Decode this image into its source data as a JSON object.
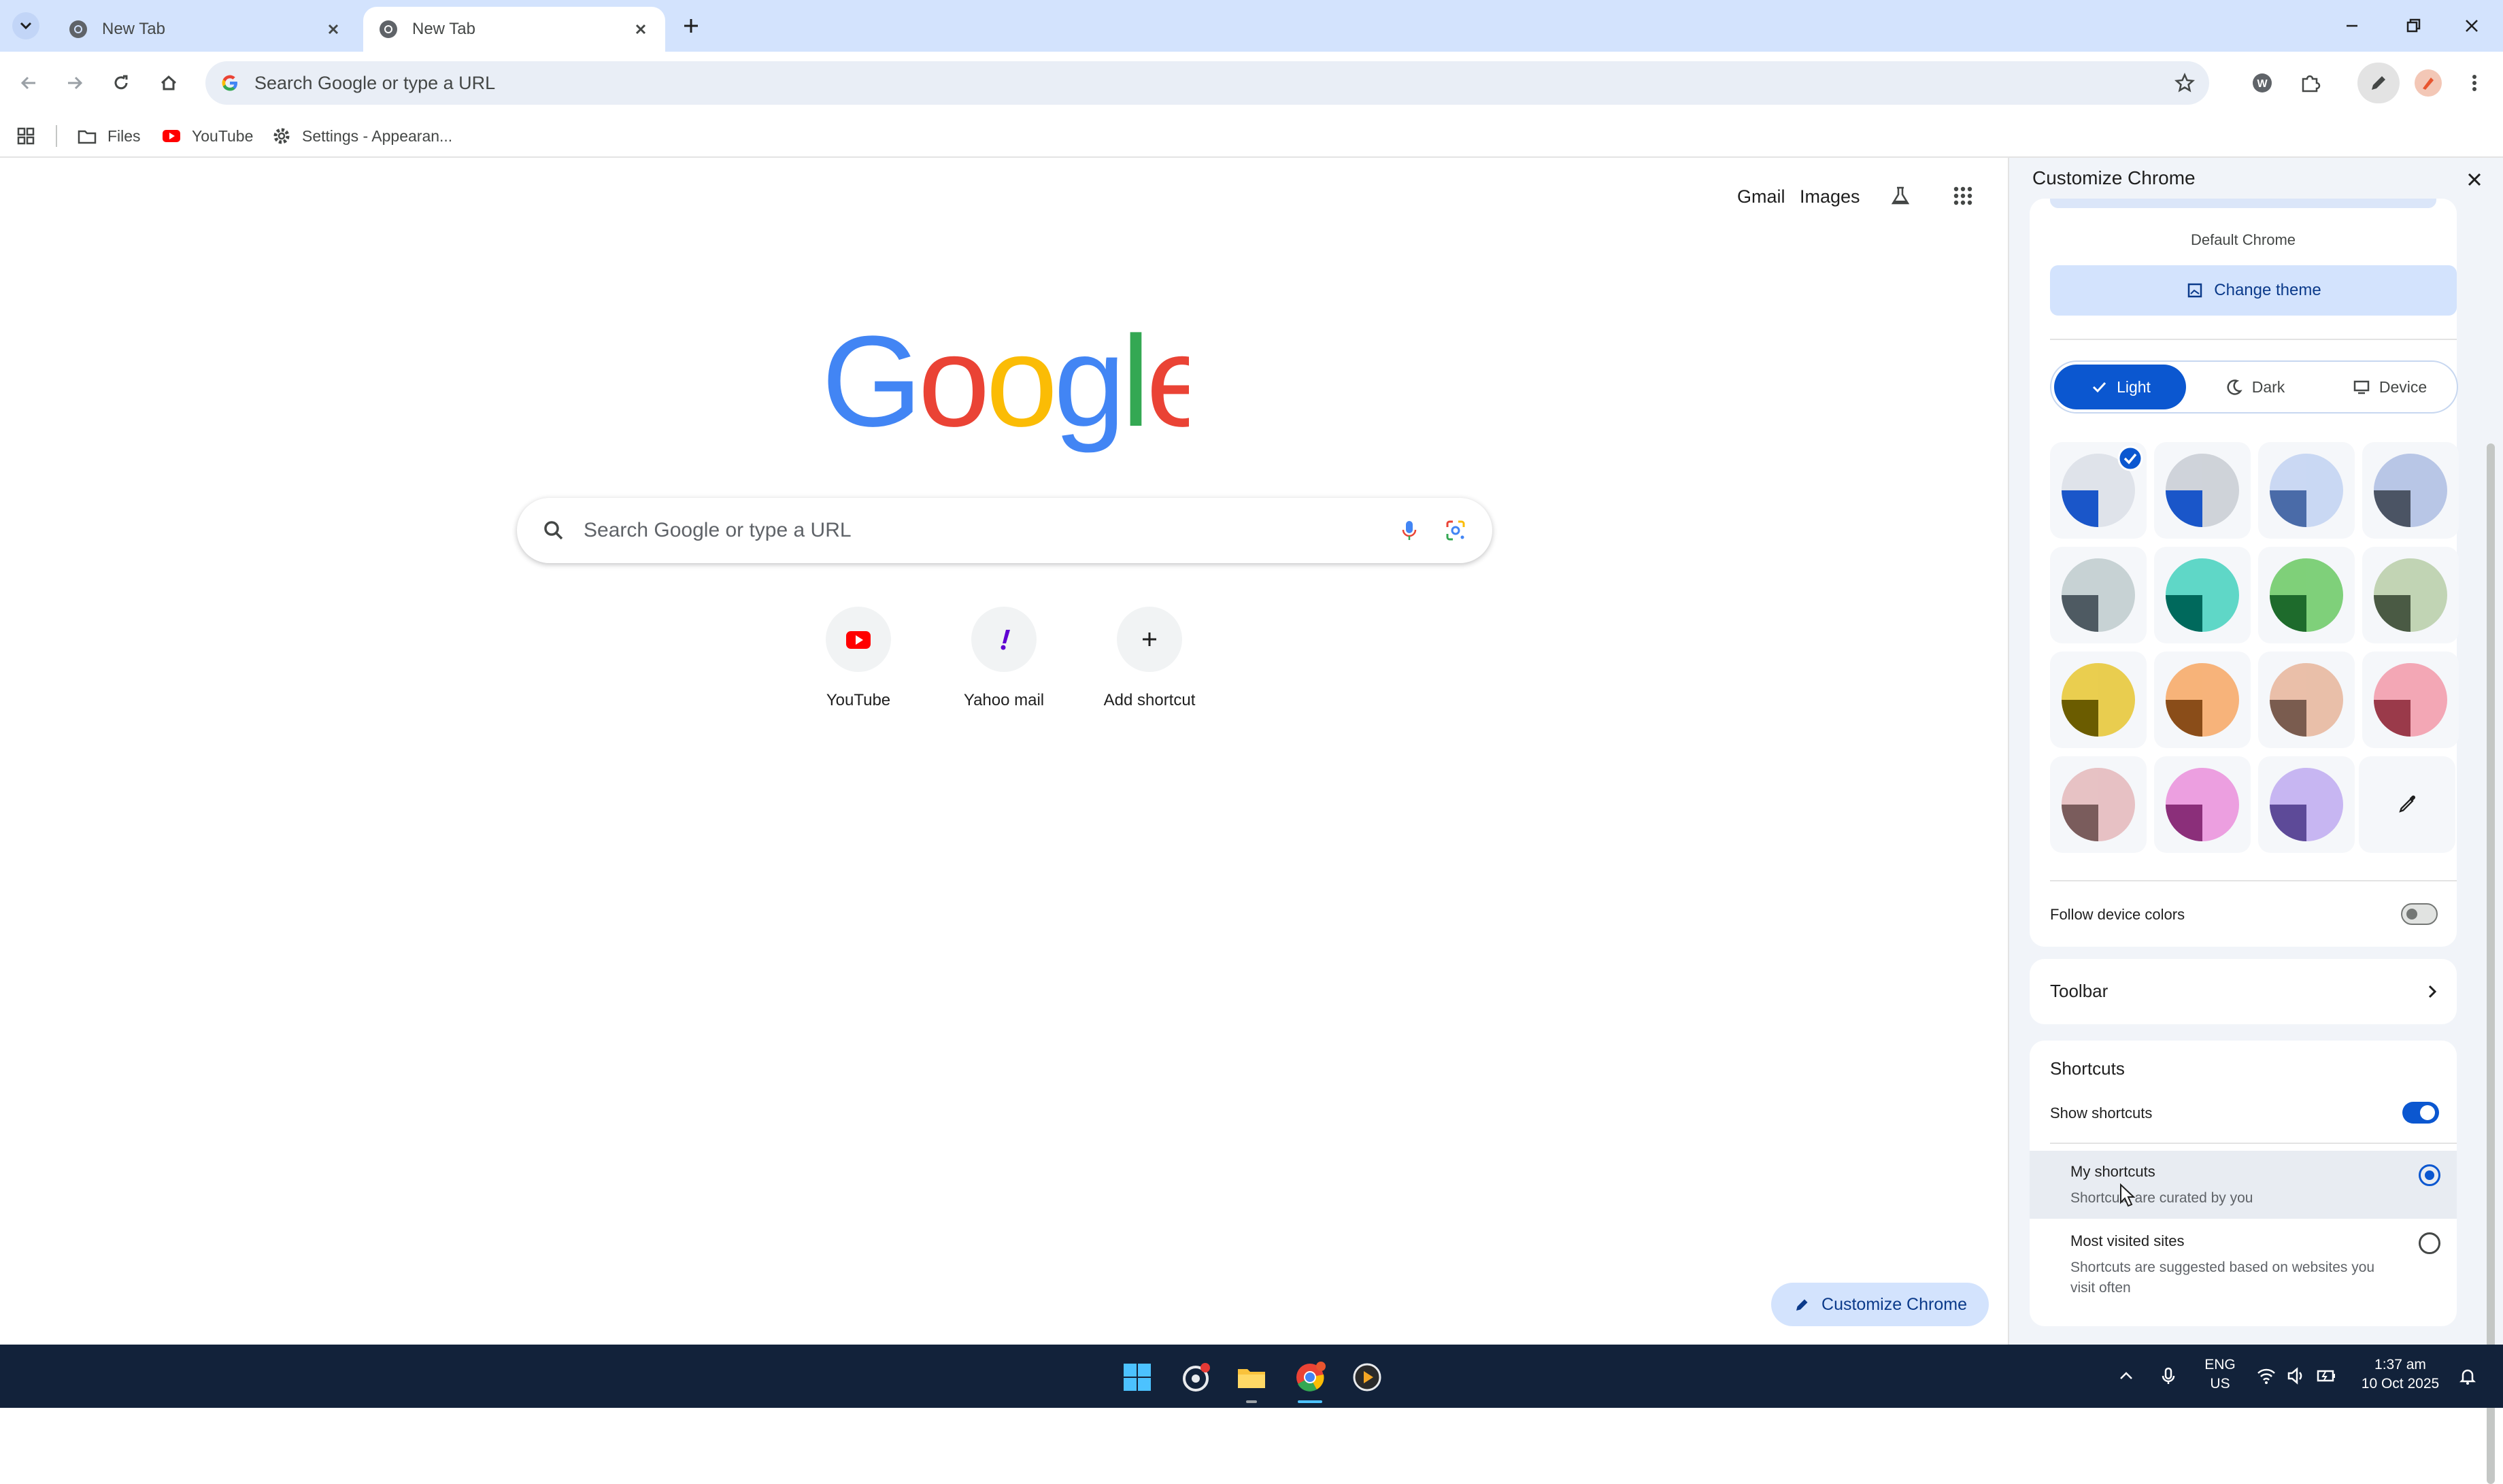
{
  "tabs": [
    {
      "title": "New Tab",
      "active": false
    },
    {
      "title": "New Tab",
      "active": true
    }
  ],
  "omnibox": {
    "placeholder": "Search Google or type a URL"
  },
  "bookmarks": [
    {
      "label": "Files",
      "icon": "folder-icon"
    },
    {
      "label": "YouTube",
      "icon": "youtube-icon"
    },
    {
      "label": "Settings - Appearan...",
      "icon": "gear-icon"
    }
  ],
  "ntp": {
    "links": {
      "gmail": "Gmail",
      "images": "Images"
    },
    "search_placeholder": "Search Google or type a URL",
    "shortcuts": [
      {
        "label": "YouTube",
        "icon": "youtube-icon"
      },
      {
        "label": "Yahoo mail",
        "icon": "yahoo-icon"
      },
      {
        "label": "Add shortcut",
        "icon": "plus-icon"
      }
    ],
    "customize_button": "Customize Chrome"
  },
  "side_panel": {
    "title": "Customize Chrome",
    "theme_name": "Default Chrome",
    "change_theme": "Change theme",
    "modes": [
      {
        "label": "Light",
        "selected": true
      },
      {
        "label": "Dark",
        "selected": false
      },
      {
        "label": "Device",
        "selected": false
      }
    ],
    "swatch_colors": [
      [
        "#1a56c9",
        "#dfe3ea"
      ],
      [
        "#1a56c9",
        "#cfd3d9"
      ],
      [
        "#4a6ba8",
        "#c9d8f3"
      ],
      [
        "#4b5464",
        "#b8c6e6"
      ],
      [
        "#4e5a62",
        "#c7d2d4"
      ],
      [
        "#00695c",
        "#5fd7c7"
      ],
      [
        "#1e6b2c",
        "#7fd07a"
      ],
      [
        "#4a5a44",
        "#c1d4b4"
      ],
      [
        "#6b5c00",
        "#e9cd4f"
      ],
      [
        "#8a4d19",
        "#f7b37a"
      ],
      [
        "#7a5c4f",
        "#e9bfa9"
      ],
      [
        "#9a3a4a",
        "#f3a7b5"
      ],
      [
        "#7a5c5c",
        "#e7c1c4"
      ],
      [
        "#8b2f7a",
        "#ec9fe0"
      ],
      [
        "#5d4a98",
        "#c7b6f2"
      ]
    ],
    "follow_device_colors": {
      "label": "Follow device colors",
      "on": false
    },
    "toolbar_label": "Toolbar",
    "shortcuts": {
      "heading": "Shortcuts",
      "show_label": "Show shortcuts",
      "show_on": true,
      "options": [
        {
          "title": "My shortcuts",
          "desc": "Shortcuts are curated by you",
          "selected": true
        },
        {
          "title": "Most visited sites",
          "desc_line1": "Shortcuts are suggested based on websites you",
          "desc_line2": "visit often",
          "selected": false
        }
      ]
    }
  },
  "taskbar": {
    "lang_top": "ENG",
    "lang_bottom": "US",
    "time": "1:37 am",
    "date": "10 Oct 2025"
  },
  "colors": {
    "accent": "#0b57d0",
    "tab_strip": "#d3e3fd",
    "taskbar": "#12223a"
  }
}
